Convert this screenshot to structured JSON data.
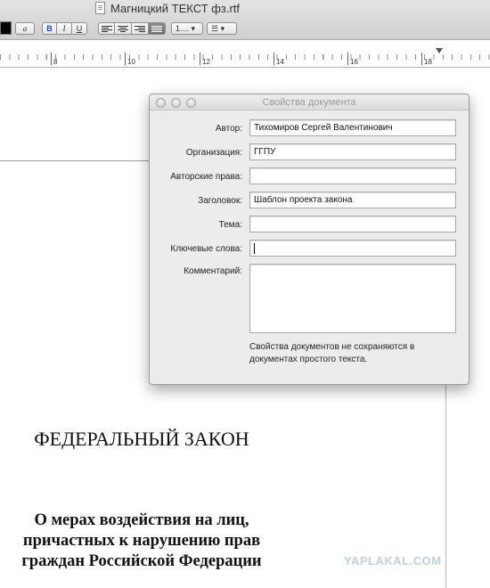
{
  "window": {
    "title": "Магницкий ТЕКСТ фз.rtf"
  },
  "toolbar": {
    "text_color": "#000000",
    "font_color_button": "a",
    "bold_label": "B",
    "italic_label": "I",
    "underline_label": "U",
    "alignment_selected": "justify",
    "line_spacing_label": "1.... ▾",
    "list_label": "☰ ▾"
  },
  "ruler": {
    "labels": [
      "8",
      "10",
      "12",
      "14",
      "16",
      "18"
    ]
  },
  "properties_panel": {
    "title": "Свойства документа",
    "fields": [
      {
        "label": "Автор:",
        "value": ""
      },
      {
        "label": "Организация:",
        "value": ""
      },
      {
        "label": "Авторские права:",
        "value": ""
      },
      {
        "label": "Заголовок:",
        "value": ""
      },
      {
        "label": "Тема:",
        "value": ""
      },
      {
        "label": "Ключевые слова:",
        "value": ""
      }
    ],
    "author_value": "Тихомиров Сергей Валентинович",
    "organization_value": "ГГПУ",
    "copyright_value": "",
    "title_value": "Шаблон проекта закона",
    "subject_value": "",
    "keywords_value": "",
    "comment_label": "Комментарий:",
    "comment_value": "",
    "note": "Свойства документов не сохраняются в документах простого текста."
  },
  "document": {
    "heading": "ФЕДЕРАЛЬНЫЙ ЗАКОН",
    "subtitle_lines": [
      "О мерах воздействия на лиц,",
      "причастных к нарушению прав",
      "граждан Российской Федерации"
    ]
  },
  "watermark": "YAPLAKAL.COM"
}
